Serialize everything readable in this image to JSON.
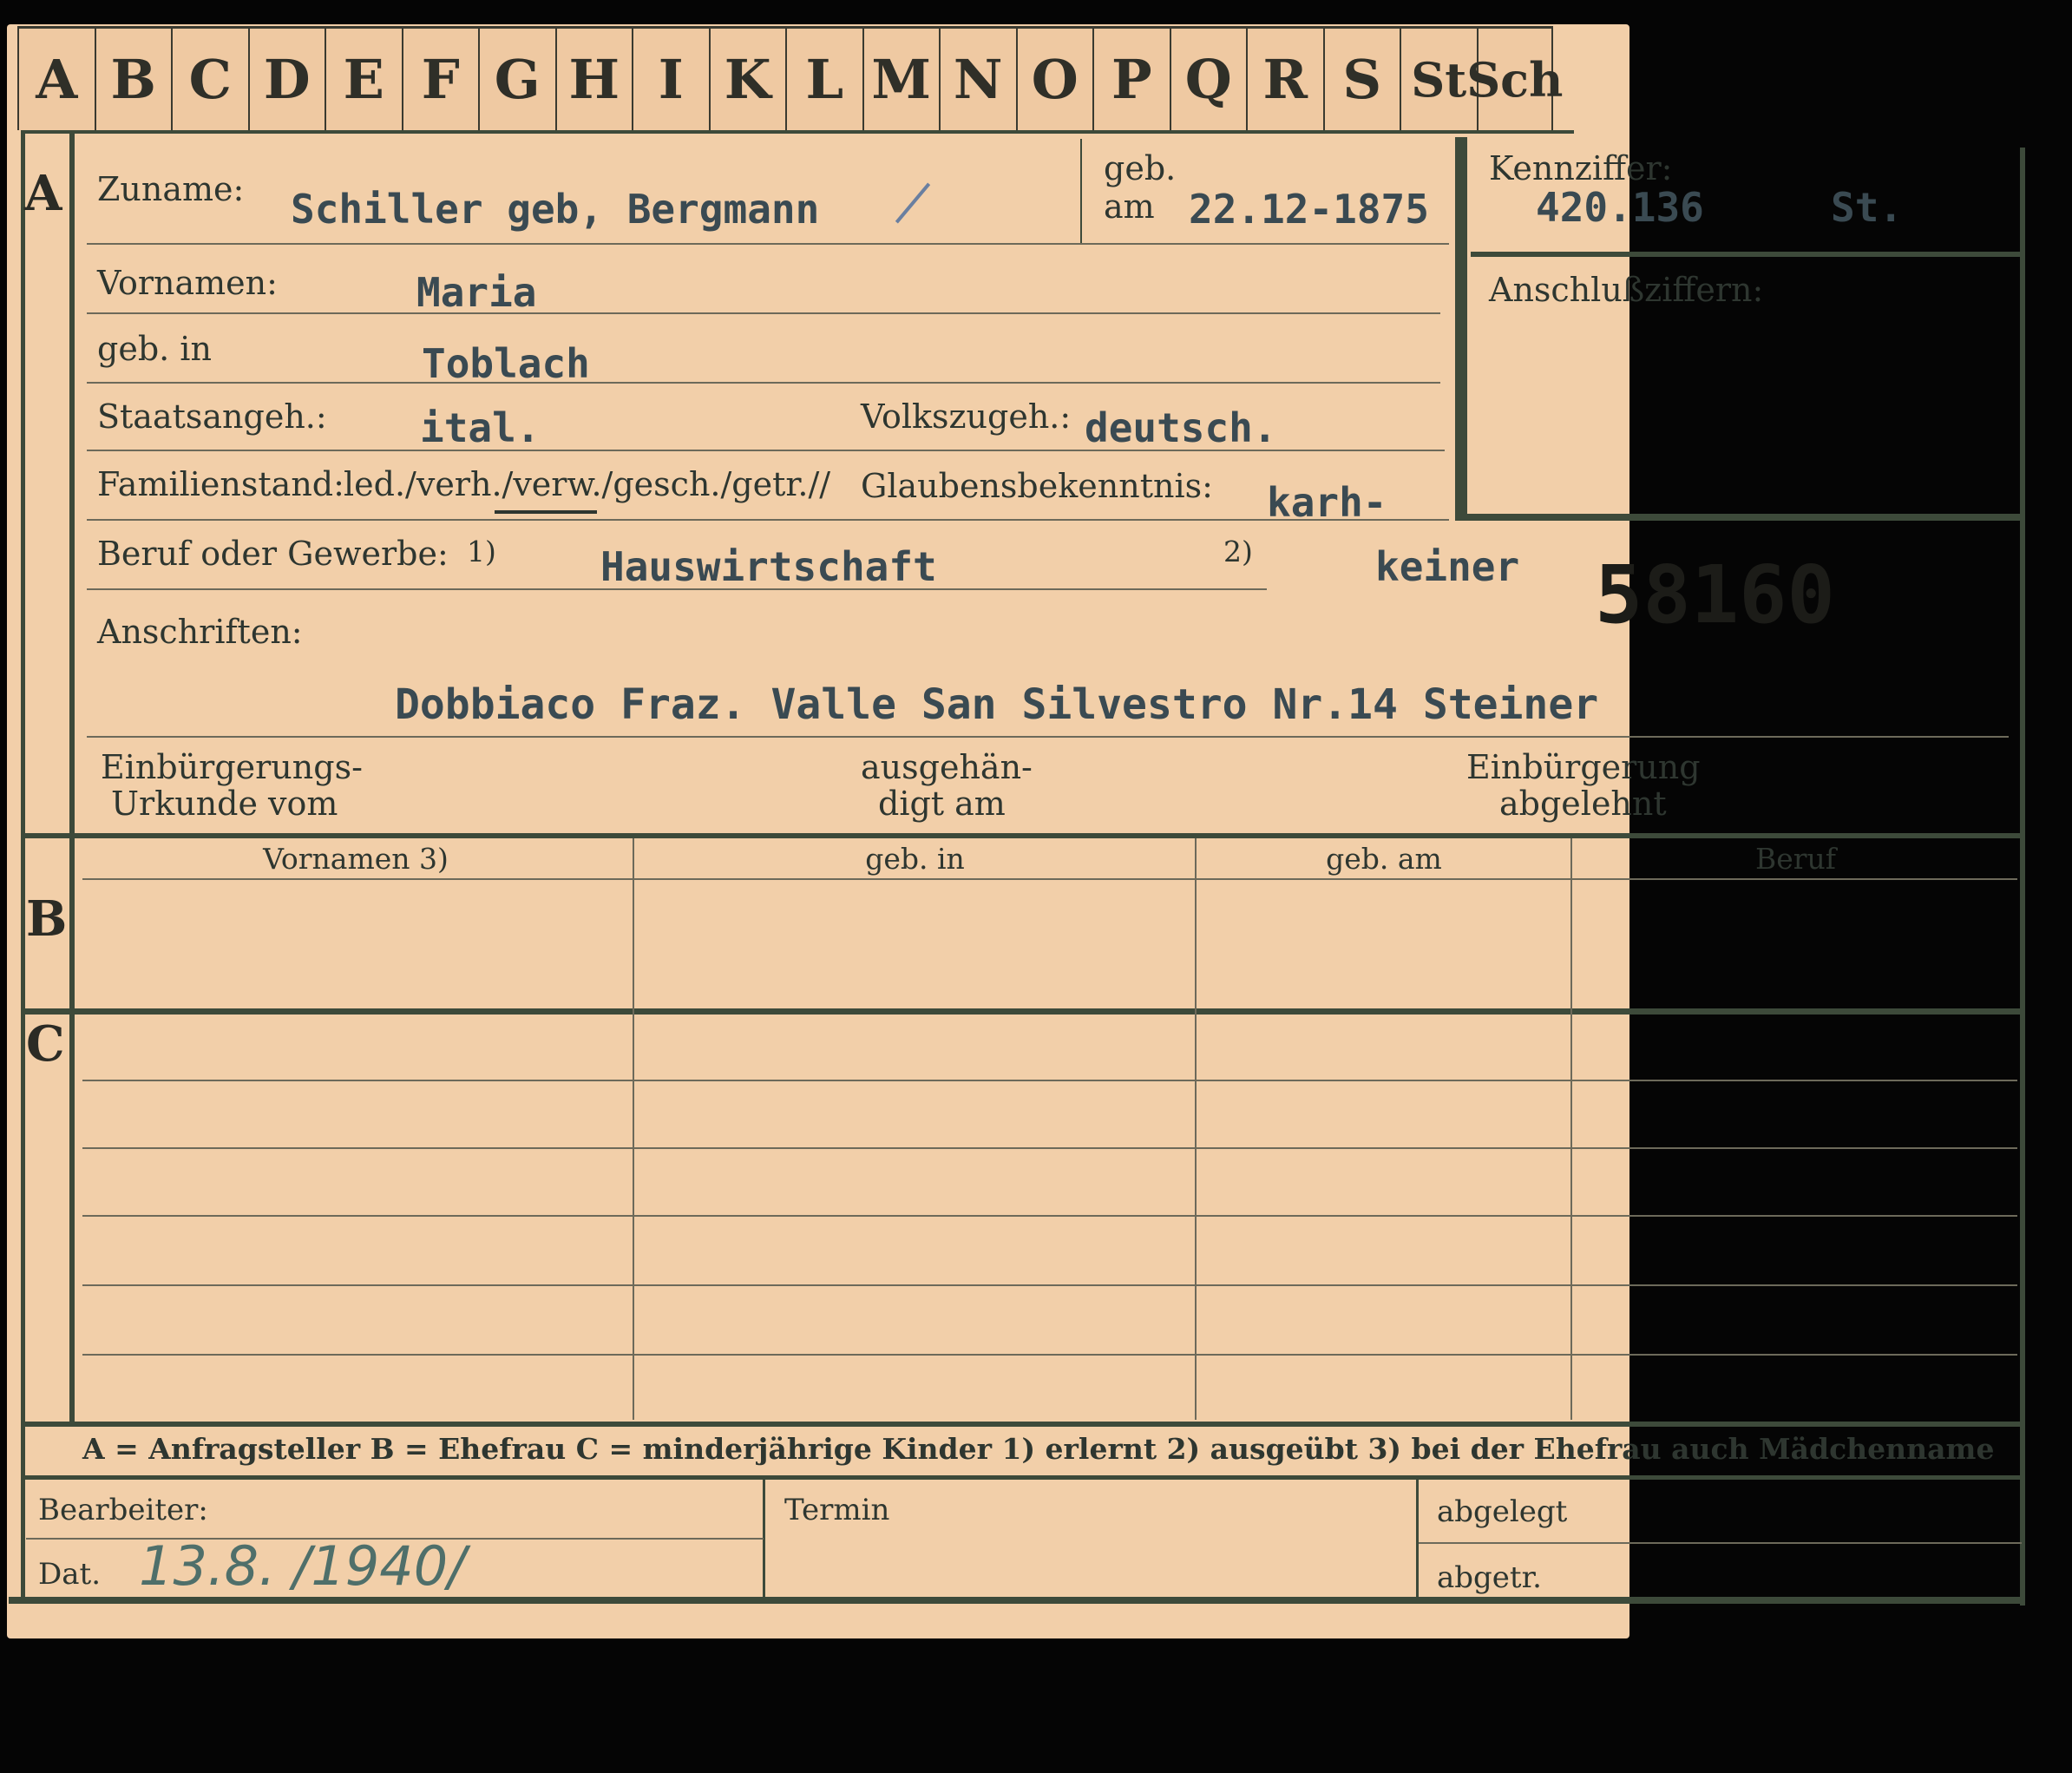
{
  "alphabet_tabs": [
    "A",
    "B",
    "C",
    "D",
    "E",
    "F",
    "G",
    "H",
    "I",
    "K",
    "L",
    "M",
    "N",
    "O",
    "P",
    "Q",
    "R",
    "S",
    "St",
    "Sch"
  ],
  "section_letters": {
    "a": "A",
    "b": "B",
    "c": "C"
  },
  "section_a": {
    "surname_label": "Zuname:",
    "surname_value": "Schiller geb, Bergmann",
    "birth_label_1": "geb.",
    "birth_label_2": "am",
    "birth_date": "22.12-1875",
    "first_names_label": "Vornamen:",
    "first_names_value": "Maria",
    "birthplace_label": "geb. in",
    "birthplace_value": "Toblach",
    "citizenship_label": "Staatsangeh.:",
    "citizenship_value": "ital.",
    "ethnicity_label": "Volkszugeh.:",
    "ethnicity_value": "deutsch.",
    "marital_label": "Familienstand:",
    "marital_value": "led./verh./verw./gesch./getr.//",
    "religion_label": "Glaubensbekenntnis:",
    "religion_value": "karh-",
    "occupation_label": "Beruf oder Gewerbe:",
    "occupation_note_1": "1)",
    "occupation_value_1": "Hauswirtschaft",
    "occupation_note_2": "2)",
    "occupation_value_2": "keiner",
    "case_number": "58160",
    "address_label": "Anschriften:",
    "address_value": "Dobbiaco Fraz. Valle San Silvestro Nr.14 Steiner",
    "naturalization_label_1": "Einbürgerungs-",
    "naturalization_label_2": "Urkunde vom",
    "delivered_label_1": "ausgehän-",
    "delivered_label_2": "digt am",
    "rejected_label_1": "Einbürgerung",
    "rejected_label_2": "abgelehnt"
  },
  "id_box": {
    "id_label": "Kennziffer:",
    "id_value": "420.136",
    "id_suffix": "St.",
    "linked_label": "Anschlußziffern:"
  },
  "section_b": {
    "columns": [
      "Vornamen 3)",
      "geb. in",
      "geb. am",
      "Beruf"
    ]
  },
  "legend": {
    "text": "A = Anfragsteller   B = Ehefrau   C = minderjährige Kinder   1) erlernt   2) ausgeübt   3) bei der Ehefrau auch Mädchenname"
  },
  "footer": {
    "clerk_label": "Bearbeiter:",
    "date_label": "Dat.",
    "date_value": "13.8. /1940/",
    "deadline_label": "Termin",
    "filed_label": "abgelegt",
    "sent_label": "abgetr."
  },
  "colors": {
    "card": "#f2cfa9",
    "ink_lines": "#3d4a3a",
    "typewriter": "#3a4a52",
    "handwriting": "#4f6f6a"
  }
}
